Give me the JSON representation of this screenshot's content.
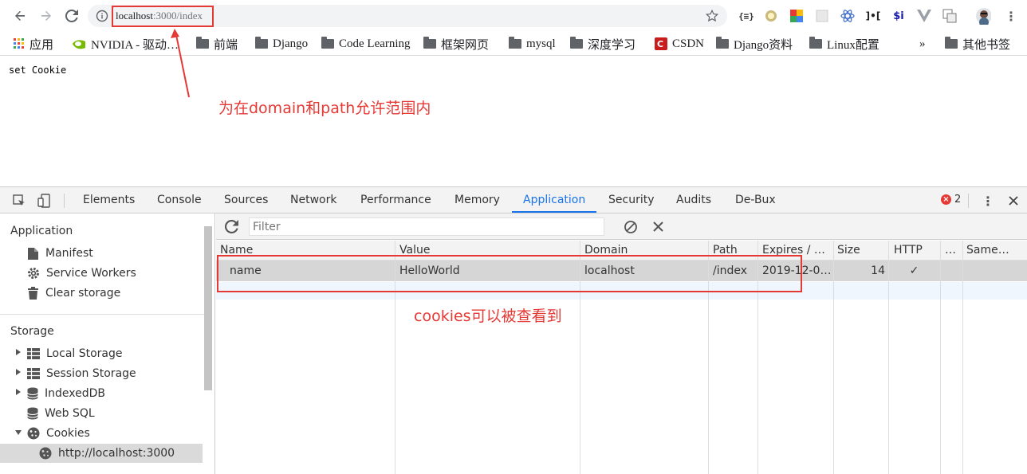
{
  "browser": {
    "url_host": "localhost",
    "url_rest": ":3000/index"
  },
  "bookmarks": [
    {
      "label": "应用",
      "icon": "apps-grid-icon"
    },
    {
      "label": "NVIDIA - 驱动…",
      "icon": "nvidia-icon"
    },
    {
      "label": "前端",
      "icon": "folder-icon"
    },
    {
      "label": "Django",
      "icon": "folder-icon"
    },
    {
      "label": "Code Learning",
      "icon": "folder-icon"
    },
    {
      "label": "框架网页",
      "icon": "folder-icon"
    },
    {
      "label": "mysql",
      "icon": "folder-icon"
    },
    {
      "label": "深度学习",
      "icon": "folder-icon"
    },
    {
      "label": "CSDN",
      "icon": "csdn-icon"
    },
    {
      "label": "Django资料",
      "icon": "folder-icon"
    },
    {
      "label": "Linux配置",
      "icon": "folder-icon"
    },
    {
      "label": "»",
      "icon": "overflow-chevron-icon"
    },
    {
      "label": "其他书签",
      "icon": "folder-icon"
    }
  ],
  "page": {
    "text": "set Cookie"
  },
  "annotations": {
    "domain_note": "为在domain和path允许范围内",
    "cookies_note": "cookies可以被查看到",
    "color": "#e53935"
  },
  "devtools": {
    "tabs": [
      "Elements",
      "Console",
      "Sources",
      "Network",
      "Performance",
      "Memory",
      "Application",
      "Security",
      "Audits",
      "De-Bux"
    ],
    "active_tab": "Application",
    "error_count": "2",
    "accent": "#1a73e8",
    "sidebar": {
      "application_title": "Application",
      "application_items": [
        "Manifest",
        "Service Workers",
        "Clear storage"
      ],
      "storage_title": "Storage",
      "storage_items": [
        "Local Storage",
        "Session Storage",
        "IndexedDB",
        "Web SQL",
        "Cookies"
      ],
      "cookie_origin": "http://localhost:3000"
    },
    "filter_placeholder": "Filter",
    "columns": [
      "Name",
      "Value",
      "Domain",
      "Path",
      "Expires / …",
      "Size",
      "HTTP",
      "…",
      "Same…"
    ],
    "rows": [
      {
        "name": "name",
        "value": "HelloWorld",
        "domain": "localhost",
        "path": "/index",
        "expires": "2019-12-0…",
        "size": "14",
        "http": "✓",
        "secure": "",
        "samesite": ""
      }
    ]
  }
}
